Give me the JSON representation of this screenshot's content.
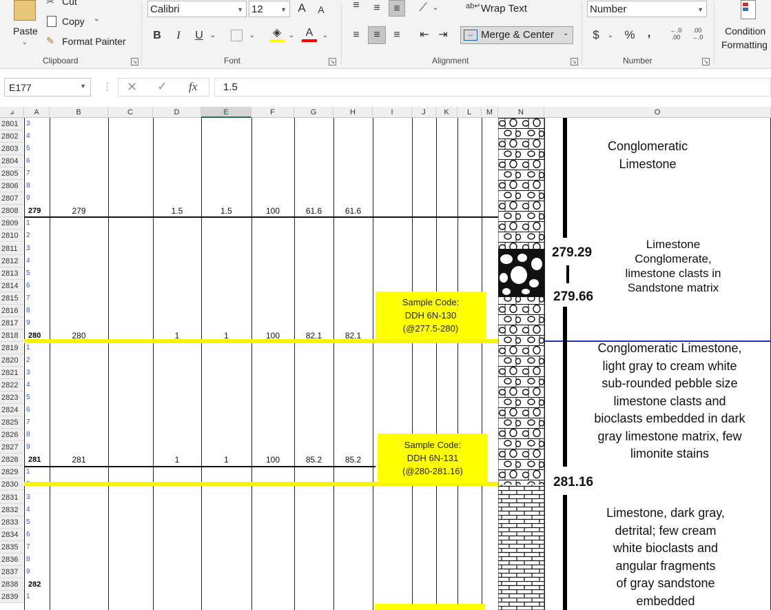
{
  "ribbon": {
    "clipboard": {
      "paste": "Paste",
      "cut": "Cut",
      "copy": "Copy",
      "format_painter": "Format Painter",
      "group": "Clipboard"
    },
    "font": {
      "name": "Calibri",
      "size": "12",
      "bold": "B",
      "italic": "I",
      "underline": "U",
      "grow": "A",
      "shrink": "A",
      "group": "Font",
      "fill_color": "#ffff00",
      "font_color": "#ff0000"
    },
    "alignment": {
      "wrap_text": "Wrap Text",
      "merge_center": "Merge & Center",
      "group": "Alignment"
    },
    "number": {
      "format": "Number",
      "currency": "$",
      "percent": "%",
      "comma": ",",
      "group": "Number"
    },
    "styles": {
      "conditional": "Condition",
      "formatting": "Formatting"
    }
  },
  "formula_bar": {
    "name_box": "E177",
    "fx": "fx",
    "value": "1.5"
  },
  "columns": [
    "A",
    "B",
    "C",
    "D",
    "E",
    "F",
    "G",
    "H",
    "I",
    "J",
    "K",
    "L",
    "M",
    "N",
    "O"
  ],
  "selected_column": "E",
  "rows": [
    {
      "n": "2801",
      "a": "3"
    },
    {
      "n": "2802",
      "a": "4"
    },
    {
      "n": "2803",
      "a": "5"
    },
    {
      "n": "2804",
      "a": "6"
    },
    {
      "n": "2805",
      "a": "7"
    },
    {
      "n": "2806",
      "a": "8"
    },
    {
      "n": "2807",
      "a": "9"
    },
    {
      "n": "2808",
      "a": "279",
      "main": true
    },
    {
      "n": "2809",
      "a": "1"
    },
    {
      "n": "2810",
      "a": "2"
    },
    {
      "n": "2811",
      "a": "3"
    },
    {
      "n": "2812",
      "a": "4"
    },
    {
      "n": "2813",
      "a": "5"
    },
    {
      "n": "2814",
      "a": "6"
    },
    {
      "n": "2815",
      "a": "7"
    },
    {
      "n": "2816",
      "a": "8"
    },
    {
      "n": "2817",
      "a": "9"
    },
    {
      "n": "2818",
      "a": "280",
      "main": true
    },
    {
      "n": "2819",
      "a": "1"
    },
    {
      "n": "2820",
      "a": "2"
    },
    {
      "n": "2821",
      "a": "3"
    },
    {
      "n": "2822",
      "a": "4"
    },
    {
      "n": "2823",
      "a": "5"
    },
    {
      "n": "2824",
      "a": "6"
    },
    {
      "n": "2825",
      "a": "7"
    },
    {
      "n": "2826",
      "a": "8"
    },
    {
      "n": "2827",
      "a": "9"
    },
    {
      "n": "2828",
      "a": "281",
      "main": true
    },
    {
      "n": "2829",
      "a": "1"
    },
    {
      "n": "2830",
      "a": "2"
    },
    {
      "n": "2831",
      "a": "3"
    },
    {
      "n": "2832",
      "a": "4"
    },
    {
      "n": "2833",
      "a": "5"
    },
    {
      "n": "2834",
      "a": "6"
    },
    {
      "n": "2835",
      "a": "7"
    },
    {
      "n": "2836",
      "a": "8"
    },
    {
      "n": "2837",
      "a": "9"
    },
    {
      "n": "2838",
      "a": "282",
      "main": true
    },
    {
      "n": "2839",
      "a": "1"
    }
  ],
  "data_rows": [
    {
      "b": "279",
      "d": "1.5",
      "e": "1.5",
      "f": "100",
      "g": "61.6",
      "h": "61.6"
    },
    {
      "b": "280",
      "d": "1",
      "e": "1",
      "f": "100",
      "g": "82.1",
      "h": "82.1"
    },
    {
      "b": "281",
      "d": "1",
      "e": "1",
      "f": "100",
      "g": "85.2",
      "h": "85.2"
    }
  ],
  "samples": [
    {
      "line1": "Sample Code:",
      "line2": "DDH 6N-130",
      "line3": "(@277.5-280)"
    },
    {
      "line1": "Sample Code:",
      "line2": "DDH 6N-131",
      "line3": "(@280-281.16)"
    }
  ],
  "depths": [
    "279.29",
    "279.66",
    "281.16"
  ],
  "descriptions": {
    "d1": [
      "Conglomeratic",
      "Limestone"
    ],
    "d2": [
      "Limestone",
      "Conglomerate,",
      "limestone clasts in",
      "Sandstone matrix"
    ],
    "d3": [
      "Conglomeratic Limestone,",
      "light gray to cream white",
      "sub-rounded pebble size",
      "limestone clasts and",
      "bioclasts embedded in dark",
      "gray limestone matrix, few",
      "limonite stains"
    ],
    "d4": [
      "Limestone, dark gray,",
      "detrital; few cream",
      "white bioclasts and",
      "angular fragments",
      "of gray sandstone",
      "embedded"
    ]
  }
}
